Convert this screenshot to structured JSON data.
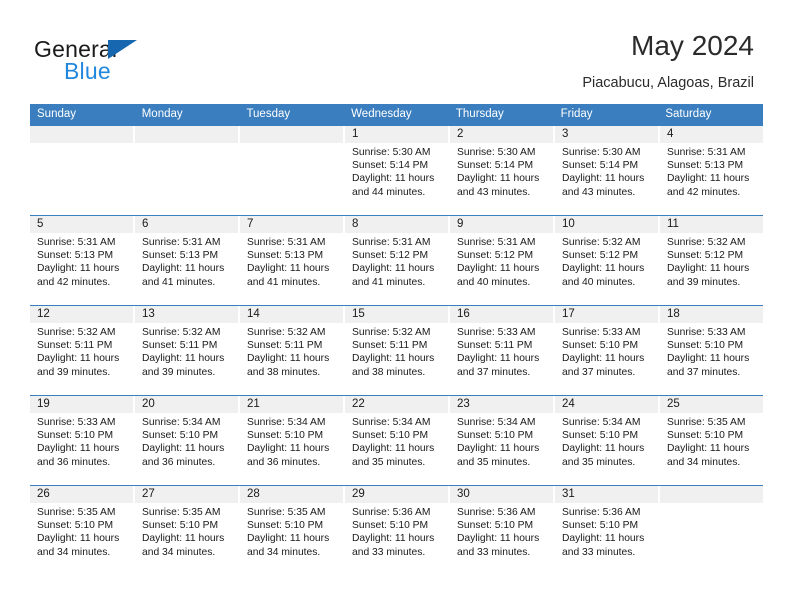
{
  "brand": {
    "name_part1": "General",
    "name_part2": "Blue",
    "triangle_color": "#1666b0",
    "blue_color": "#2288dd"
  },
  "header": {
    "title": "May 2024",
    "subtitle": "Piacabucu, Alagoas, Brazil"
  },
  "calendar": {
    "accent_color": "#3a7ebf",
    "daynum_band_color": "#f0f0f0",
    "weekdays": [
      "Sunday",
      "Monday",
      "Tuesday",
      "Wednesday",
      "Thursday",
      "Friday",
      "Saturday"
    ],
    "weeks": [
      [
        {
          "day": "",
          "sunrise": "",
          "sunset": "",
          "daylight1": "",
          "daylight2": ""
        },
        {
          "day": "",
          "sunrise": "",
          "sunset": "",
          "daylight1": "",
          "daylight2": ""
        },
        {
          "day": "",
          "sunrise": "",
          "sunset": "",
          "daylight1": "",
          "daylight2": ""
        },
        {
          "day": "1",
          "sunrise": "Sunrise: 5:30 AM",
          "sunset": "Sunset: 5:14 PM",
          "daylight1": "Daylight: 11 hours",
          "daylight2": "and 44 minutes."
        },
        {
          "day": "2",
          "sunrise": "Sunrise: 5:30 AM",
          "sunset": "Sunset: 5:14 PM",
          "daylight1": "Daylight: 11 hours",
          "daylight2": "and 43 minutes."
        },
        {
          "day": "3",
          "sunrise": "Sunrise: 5:30 AM",
          "sunset": "Sunset: 5:14 PM",
          "daylight1": "Daylight: 11 hours",
          "daylight2": "and 43 minutes."
        },
        {
          "day": "4",
          "sunrise": "Sunrise: 5:31 AM",
          "sunset": "Sunset: 5:13 PM",
          "daylight1": "Daylight: 11 hours",
          "daylight2": "and 42 minutes."
        }
      ],
      [
        {
          "day": "5",
          "sunrise": "Sunrise: 5:31 AM",
          "sunset": "Sunset: 5:13 PM",
          "daylight1": "Daylight: 11 hours",
          "daylight2": "and 42 minutes."
        },
        {
          "day": "6",
          "sunrise": "Sunrise: 5:31 AM",
          "sunset": "Sunset: 5:13 PM",
          "daylight1": "Daylight: 11 hours",
          "daylight2": "and 41 minutes."
        },
        {
          "day": "7",
          "sunrise": "Sunrise: 5:31 AM",
          "sunset": "Sunset: 5:13 PM",
          "daylight1": "Daylight: 11 hours",
          "daylight2": "and 41 minutes."
        },
        {
          "day": "8",
          "sunrise": "Sunrise: 5:31 AM",
          "sunset": "Sunset: 5:12 PM",
          "daylight1": "Daylight: 11 hours",
          "daylight2": "and 41 minutes."
        },
        {
          "day": "9",
          "sunrise": "Sunrise: 5:31 AM",
          "sunset": "Sunset: 5:12 PM",
          "daylight1": "Daylight: 11 hours",
          "daylight2": "and 40 minutes."
        },
        {
          "day": "10",
          "sunrise": "Sunrise: 5:32 AM",
          "sunset": "Sunset: 5:12 PM",
          "daylight1": "Daylight: 11 hours",
          "daylight2": "and 40 minutes."
        },
        {
          "day": "11",
          "sunrise": "Sunrise: 5:32 AM",
          "sunset": "Sunset: 5:12 PM",
          "daylight1": "Daylight: 11 hours",
          "daylight2": "and 39 minutes."
        }
      ],
      [
        {
          "day": "12",
          "sunrise": "Sunrise: 5:32 AM",
          "sunset": "Sunset: 5:11 PM",
          "daylight1": "Daylight: 11 hours",
          "daylight2": "and 39 minutes."
        },
        {
          "day": "13",
          "sunrise": "Sunrise: 5:32 AM",
          "sunset": "Sunset: 5:11 PM",
          "daylight1": "Daylight: 11 hours",
          "daylight2": "and 39 minutes."
        },
        {
          "day": "14",
          "sunrise": "Sunrise: 5:32 AM",
          "sunset": "Sunset: 5:11 PM",
          "daylight1": "Daylight: 11 hours",
          "daylight2": "and 38 minutes."
        },
        {
          "day": "15",
          "sunrise": "Sunrise: 5:32 AM",
          "sunset": "Sunset: 5:11 PM",
          "daylight1": "Daylight: 11 hours",
          "daylight2": "and 38 minutes."
        },
        {
          "day": "16",
          "sunrise": "Sunrise: 5:33 AM",
          "sunset": "Sunset: 5:11 PM",
          "daylight1": "Daylight: 11 hours",
          "daylight2": "and 37 minutes."
        },
        {
          "day": "17",
          "sunrise": "Sunrise: 5:33 AM",
          "sunset": "Sunset: 5:10 PM",
          "daylight1": "Daylight: 11 hours",
          "daylight2": "and 37 minutes."
        },
        {
          "day": "18",
          "sunrise": "Sunrise: 5:33 AM",
          "sunset": "Sunset: 5:10 PM",
          "daylight1": "Daylight: 11 hours",
          "daylight2": "and 37 minutes."
        }
      ],
      [
        {
          "day": "19",
          "sunrise": "Sunrise: 5:33 AM",
          "sunset": "Sunset: 5:10 PM",
          "daylight1": "Daylight: 11 hours",
          "daylight2": "and 36 minutes."
        },
        {
          "day": "20",
          "sunrise": "Sunrise: 5:34 AM",
          "sunset": "Sunset: 5:10 PM",
          "daylight1": "Daylight: 11 hours",
          "daylight2": "and 36 minutes."
        },
        {
          "day": "21",
          "sunrise": "Sunrise: 5:34 AM",
          "sunset": "Sunset: 5:10 PM",
          "daylight1": "Daylight: 11 hours",
          "daylight2": "and 36 minutes."
        },
        {
          "day": "22",
          "sunrise": "Sunrise: 5:34 AM",
          "sunset": "Sunset: 5:10 PM",
          "daylight1": "Daylight: 11 hours",
          "daylight2": "and 35 minutes."
        },
        {
          "day": "23",
          "sunrise": "Sunrise: 5:34 AM",
          "sunset": "Sunset: 5:10 PM",
          "daylight1": "Daylight: 11 hours",
          "daylight2": "and 35 minutes."
        },
        {
          "day": "24",
          "sunrise": "Sunrise: 5:34 AM",
          "sunset": "Sunset: 5:10 PM",
          "daylight1": "Daylight: 11 hours",
          "daylight2": "and 35 minutes."
        },
        {
          "day": "25",
          "sunrise": "Sunrise: 5:35 AM",
          "sunset": "Sunset: 5:10 PM",
          "daylight1": "Daylight: 11 hours",
          "daylight2": "and 34 minutes."
        }
      ],
      [
        {
          "day": "26",
          "sunrise": "Sunrise: 5:35 AM",
          "sunset": "Sunset: 5:10 PM",
          "daylight1": "Daylight: 11 hours",
          "daylight2": "and 34 minutes."
        },
        {
          "day": "27",
          "sunrise": "Sunrise: 5:35 AM",
          "sunset": "Sunset: 5:10 PM",
          "daylight1": "Daylight: 11 hours",
          "daylight2": "and 34 minutes."
        },
        {
          "day": "28",
          "sunrise": "Sunrise: 5:35 AM",
          "sunset": "Sunset: 5:10 PM",
          "daylight1": "Daylight: 11 hours",
          "daylight2": "and 34 minutes."
        },
        {
          "day": "29",
          "sunrise": "Sunrise: 5:36 AM",
          "sunset": "Sunset: 5:10 PM",
          "daylight1": "Daylight: 11 hours",
          "daylight2": "and 33 minutes."
        },
        {
          "day": "30",
          "sunrise": "Sunrise: 5:36 AM",
          "sunset": "Sunset: 5:10 PM",
          "daylight1": "Daylight: 11 hours",
          "daylight2": "and 33 minutes."
        },
        {
          "day": "31",
          "sunrise": "Sunrise: 5:36 AM",
          "sunset": "Sunset: 5:10 PM",
          "daylight1": "Daylight: 11 hours",
          "daylight2": "and 33 minutes."
        },
        {
          "day": "",
          "sunrise": "",
          "sunset": "",
          "daylight1": "",
          "daylight2": ""
        }
      ]
    ]
  }
}
